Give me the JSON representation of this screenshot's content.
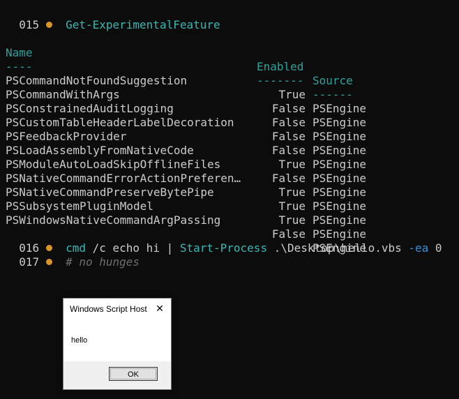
{
  "terminal": {
    "prompt1": {
      "number": "015",
      "command": "Get-ExperimentalFeature"
    },
    "table": {
      "headers": {
        "name": "Name",
        "enabled": "Enabled",
        "source": "Source"
      },
      "underlines": {
        "name": "----",
        "enabled": "-------",
        "source": "------"
      },
      "rows": [
        {
          "name": "PSCommandNotFoundSuggestion",
          "enabled": "True",
          "source": "PSEngine"
        },
        {
          "name": "PSCommandWithArgs",
          "enabled": "False",
          "source": "PSEngine"
        },
        {
          "name": "PSConstrainedAuditLogging",
          "enabled": "False",
          "source": "PSEngine"
        },
        {
          "name": "PSCustomTableHeaderLabelDecoration",
          "enabled": "False",
          "source": "PSEngine"
        },
        {
          "name": "PSFeedbackProvider",
          "enabled": "False",
          "source": "PSEngine"
        },
        {
          "name": "PSLoadAssemblyFromNativeCode",
          "enabled": "True",
          "source": "PSEngine"
        },
        {
          "name": "PSModuleAutoLoadSkipOfflineFiles",
          "enabled": "False",
          "source": "PSEngine"
        },
        {
          "name": "PSNativeCommandErrorActionPreferen…",
          "enabled": "True",
          "source": "PSEngine"
        },
        {
          "name": "PSNativeCommandPreserveBytePipe",
          "enabled": "True",
          "source": "PSEngine"
        },
        {
          "name": "PSSubsystemPluginModel",
          "enabled": "True",
          "source": "PSEngine"
        },
        {
          "name": "PSWindowsNativeCommandArgPassing",
          "enabled": "False",
          "source": "PSEngine"
        }
      ]
    },
    "prompt2": {
      "number": "016",
      "cmd": "cmd",
      "args": " /c echo hi | ",
      "cmdlet": "Start-Process",
      "path": " .\\Desktop\\hello.vbs ",
      "param": "-ea",
      "value": " 0"
    },
    "prompt3": {
      "number": "017",
      "comment": "# no hunges"
    }
  },
  "dialog": {
    "title": "Windows Script Host",
    "close_glyph": "✕",
    "message": "hello",
    "ok_label": "OK"
  },
  "colors": {
    "background": "#0c0c0c",
    "prompt_dot": "#d9952a",
    "command": "#3ab8b2",
    "comment": "#6f6f6f",
    "parameter": "#3b8fd6"
  }
}
